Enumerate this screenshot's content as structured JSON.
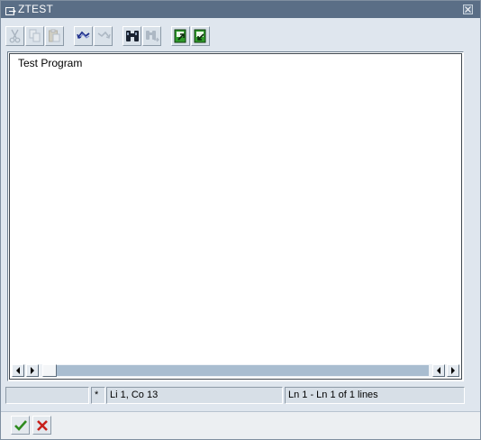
{
  "window": {
    "title": "ZTEST"
  },
  "toolbar": {
    "buttons": [
      {
        "name": "cut",
        "icon": "scissors-icon",
        "enabled": false
      },
      {
        "name": "copy",
        "icon": "copy-icon",
        "enabled": false
      },
      {
        "name": "paste",
        "icon": "clipboard-paste-icon",
        "enabled": false
      },
      {
        "name": "undo",
        "icon": "undo-icon",
        "enabled": true
      },
      {
        "name": "redo",
        "icon": "redo-icon",
        "enabled": false
      },
      {
        "name": "find",
        "icon": "binoculars-icon",
        "enabled": true
      },
      {
        "name": "find-next",
        "icon": "binoculars-next-icon",
        "enabled": false
      },
      {
        "name": "upload",
        "icon": "load-file-icon",
        "enabled": true
      },
      {
        "name": "download",
        "icon": "save-file-icon",
        "enabled": true
      }
    ]
  },
  "editor": {
    "lines": [
      "Test Program"
    ]
  },
  "status": {
    "field1": "",
    "modified": "*",
    "cursor": "Li 1, Co 13",
    "lines_info": "Ln 1 - Ln 1 of 1 lines"
  },
  "colors": {
    "title_bar": "#5a6e86",
    "frame": "#b8c8d8",
    "body": "#dfe6ee",
    "scroll_track": "#a9bdd0",
    "confirm": "#2e8b1e",
    "cancel": "#c8201a"
  }
}
